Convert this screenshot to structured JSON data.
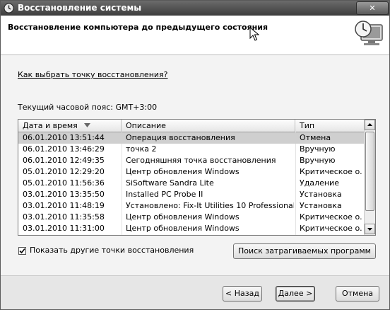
{
  "window": {
    "title": "Восстановление системы",
    "close_label": "✕"
  },
  "header": {
    "title": "Восстановление компьютера до предыдущего состояния"
  },
  "help_link": "Как выбрать точку восстановления?",
  "timezone_text": "Текущий часовой пояс: GMT+3:00",
  "table": {
    "columns": [
      "Дата и время",
      "Описание",
      "Тип"
    ],
    "sort_indicator": "▼",
    "rows": [
      {
        "datetime": "06.01.2010 13:51:44",
        "description": "Операция восстановления",
        "type": "Отмена"
      },
      {
        "datetime": "06.01.2010 13:46:29",
        "description": "точка 2",
        "type": "Вручную"
      },
      {
        "datetime": "06.01.2010 12:49:35",
        "description": "Сегодняшняя точка восстановления",
        "type": "Вручную"
      },
      {
        "datetime": "05.01.2010 12:29:20",
        "description": "Центр обновления Windows",
        "type": "Критическое о..."
      },
      {
        "datetime": "05.01.2010 11:56:36",
        "description": "SiSoftware Sandra Lite",
        "type": "Удаление"
      },
      {
        "datetime": "03.01.2010 13:35:50",
        "description": "Installed PC Probe II",
        "type": "Установка"
      },
      {
        "datetime": "03.01.2010 11:48:19",
        "description": "Установлено: Fix-It Utilities 10 Professional",
        "type": "Установка"
      },
      {
        "datetime": "03.01.2010 11:35:58",
        "description": "Центр обновления Windows",
        "type": "Критическое о..."
      },
      {
        "datetime": "03.01.2010 11:31:00",
        "description": "Центр обновления Windows",
        "type": "Критическое о..."
      }
    ],
    "selected_row": 0
  },
  "show_more": {
    "label": "Показать другие точки восстановления",
    "checked": true
  },
  "buttons": {
    "scan": "Поиск затрагиваемых программ",
    "back": "< Назад",
    "next": "Далее >",
    "cancel": "Отмена"
  },
  "icons": {
    "title": "system-restore-icon",
    "header": "clock-monitor-icon",
    "cursor": "mouse-cursor-icon"
  }
}
